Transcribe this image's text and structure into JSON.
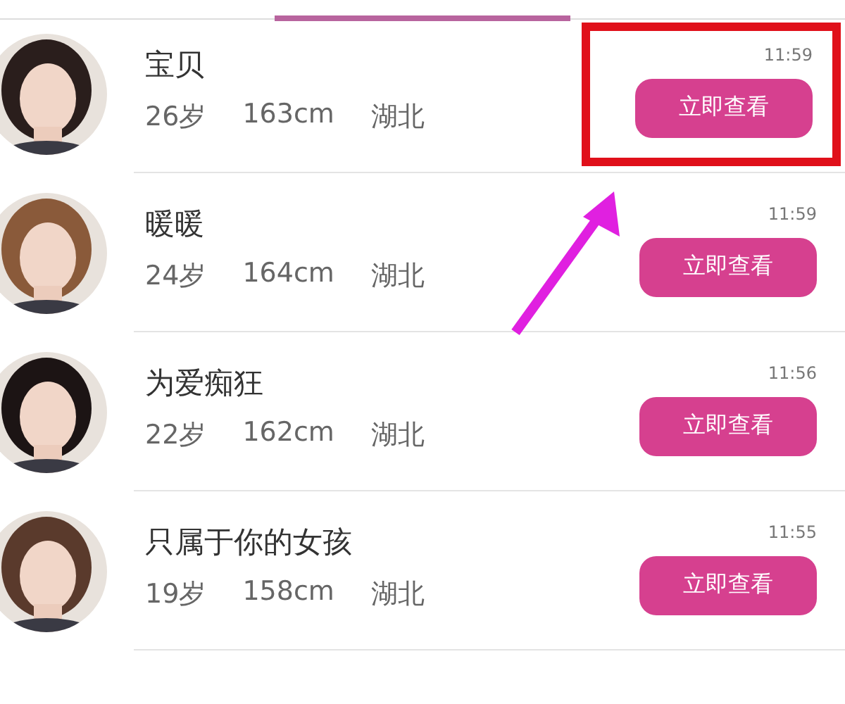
{
  "tabs": [
    {
      "selected": false
    },
    {
      "selected": true
    },
    {
      "selected": false
    }
  ],
  "contacts": [
    {
      "name": "宝贝",
      "age": "26岁",
      "height": "163cm",
      "region": "湖北",
      "time": "11:59",
      "button": "立即查看",
      "highlighted": true
    },
    {
      "name": "暖暖",
      "age": "24岁",
      "height": "164cm",
      "region": "湖北",
      "time": "11:59",
      "button": "立即查看",
      "highlighted": false
    },
    {
      "name": "为爱痴狂",
      "age": "22岁",
      "height": "162cm",
      "region": "湖北",
      "time": "11:56",
      "button": "立即查看",
      "highlighted": false
    },
    {
      "name": "只属于你的女孩",
      "age": "19岁",
      "height": "158cm",
      "region": "湖北",
      "time": "11:55",
      "button": "立即查看",
      "highlighted": false
    }
  ]
}
